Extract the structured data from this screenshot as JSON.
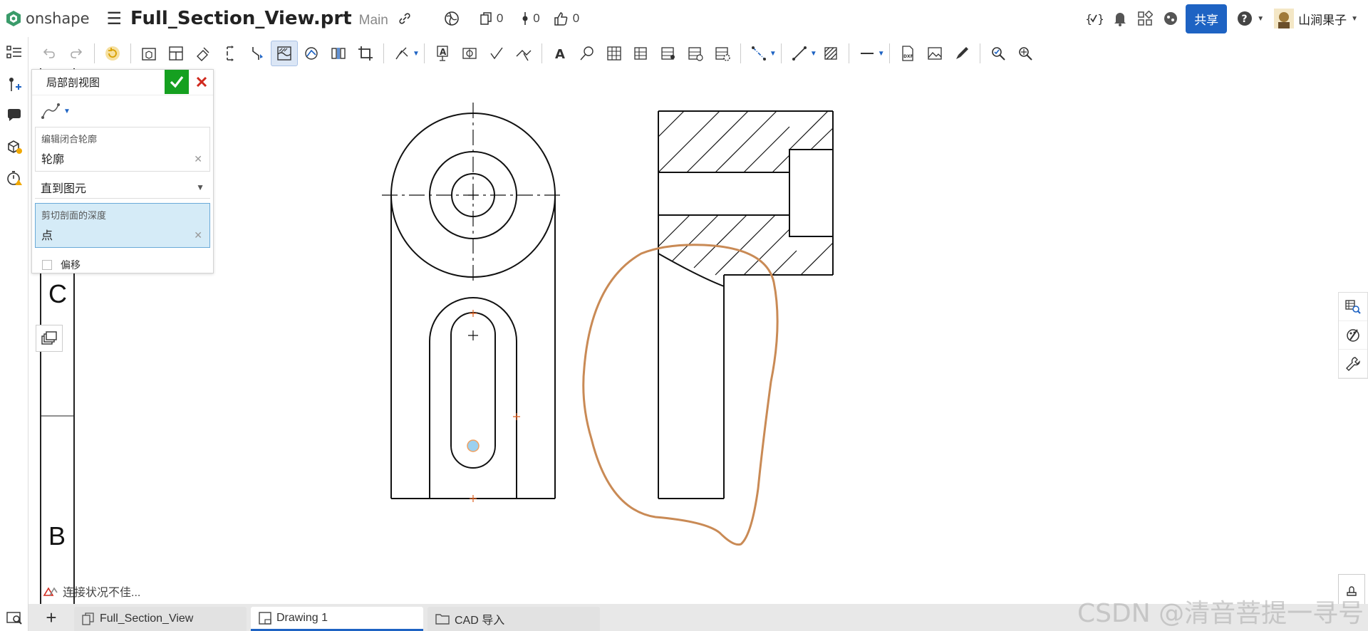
{
  "app": {
    "logo_text": "onshape",
    "doc_title": "Full_Section_View.prt",
    "branch": "Main"
  },
  "header": {
    "counts": {
      "copies": "0",
      "versions": "0",
      "likes": "0"
    },
    "share_label": "共享",
    "user_name": "山涧果子"
  },
  "panel": {
    "title": "局部剖视图",
    "closed_profile_label": "编辑闭合轮廓",
    "closed_profile_value": "轮廓",
    "end_condition": "直到图元",
    "depth_label": "剪切剖面的深度",
    "depth_value": "点",
    "offset_label": "偏移"
  },
  "sheet": {
    "zone_c": "C",
    "zone_b": "B"
  },
  "status": {
    "text": "连接状况不佳..."
  },
  "tabs": [
    {
      "label": "Full_Section_View"
    },
    {
      "label": "Drawing 1"
    },
    {
      "label": "CAD 导入"
    }
  ],
  "watermark": "CSDN @清音菩提一寻号",
  "colors": {
    "accent": "#1e63c3",
    "ok": "#15a020",
    "cancel": "#d0291d",
    "spline": "#c98a55",
    "panel_highlight": "#d5ebf7"
  }
}
